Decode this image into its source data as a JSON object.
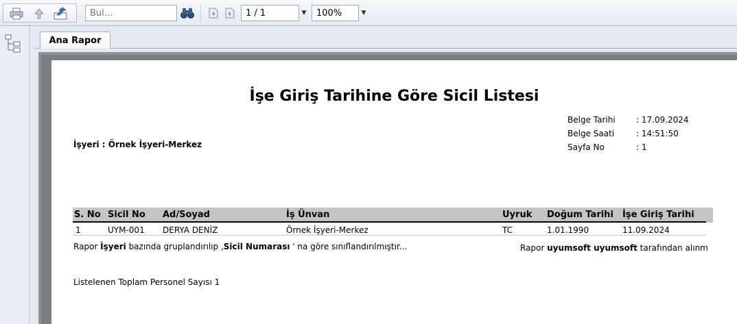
{
  "toolbar": {
    "search_placeholder": "Bul...",
    "page_value": "1 / 1",
    "zoom_value": "100%"
  },
  "tabs": [
    {
      "label": "Ana Rapor"
    }
  ],
  "report": {
    "title": "İşe Giriş Tarihine Göre Sicil Listesi",
    "meta": [
      {
        "label": "Belge Tarihi",
        "value": ": 17.09.2024"
      },
      {
        "label": "Belge Saati",
        "value": ": 14:51:50"
      },
      {
        "label": "Sayfa No",
        "value": ": 1"
      }
    ],
    "employer": "İşyeri  :  Örnek İşyeri-Merkez",
    "columns": [
      "S. No",
      "Sicil No",
      "Ad/Soyad",
      "İş Ünvan",
      "Uyruk",
      "Doğum Tarihi",
      "İşe Giriş Tarihi"
    ],
    "rows": [
      [
        "1",
        "UYM-001",
        "DERYA DENİZ",
        "Örnek İşyeri-Merkez",
        "TC",
        "1.01.1990",
        "11.09.2024"
      ]
    ],
    "footnote": {
      "p1": "Rapor ",
      "b1": "İşyeri",
      "p2": " bazında gruplandırılıp ,",
      "b2": "Sicil Numarası",
      "p3": " ' na göre sınıflandırılmıştır..."
    },
    "author": {
      "p1": "Rapor  ",
      "b1": "uyumsoft uyumsoft",
      "p2": " tarafından alınm"
    },
    "total": "Listelenen Toplam Personel Sayısı 1"
  }
}
